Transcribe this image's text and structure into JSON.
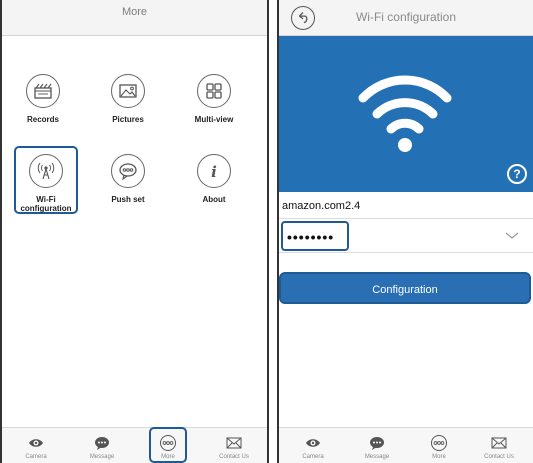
{
  "left_screen": {
    "title": "More",
    "grid": [
      {
        "label": "Records",
        "icon": "records-icon"
      },
      {
        "label": "Pictures",
        "icon": "pictures-icon"
      },
      {
        "label": "Multi-view",
        "icon": "multi-view-icon"
      },
      {
        "label": "Wi-Fi configuration",
        "icon": "wifi-antenna-icon"
      },
      {
        "label": "Push set",
        "icon": "push-set-icon"
      },
      {
        "label": "About",
        "icon": "info-icon"
      }
    ]
  },
  "right_screen": {
    "title": "Wi-Fi configuration",
    "ssid": "amazon.com2.4",
    "password_masked": "••••••••",
    "help_symbol": "?",
    "configure_button": "Configuration"
  },
  "tabbar": {
    "tabs": [
      {
        "label": "Camera",
        "icon": "camera-eye-icon"
      },
      {
        "label": "Message",
        "icon": "message-bubble-icon"
      },
      {
        "label": "More",
        "icon": "more-dots-icon"
      },
      {
        "label": "Contact Us",
        "icon": "envelope-icon"
      }
    ],
    "selected": "More"
  },
  "colors": {
    "accent_blue": "#2470b5",
    "highlight_border": "#1e5a96",
    "tab_text": "#888888"
  }
}
